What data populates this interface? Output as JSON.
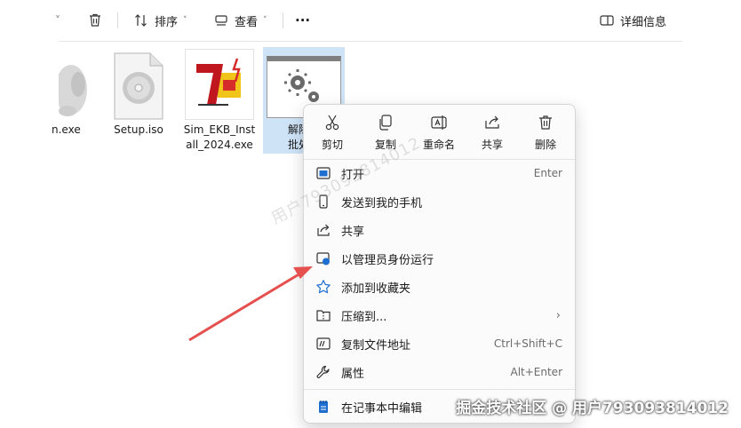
{
  "toolbar": {
    "sort_label": "排序",
    "view_label": "查看",
    "more_label": "···",
    "details_label": "详细信息"
  },
  "files": [
    {
      "name": "n.exe",
      "icon": "app-icon"
    },
    {
      "name": "Setup.iso",
      "icon": "disc-image-icon"
    },
    {
      "name": "Sim_EKB_Install_2024.exe",
      "line1": "Sim_EKB_Inst",
      "line2": "all_2024.exe",
      "icon": "installer-icon"
    },
    {
      "name": "解除重…批处理",
      "line1": "解除重",
      "line2": "批处理",
      "icon": "batch-file-icon",
      "selected": true
    }
  ],
  "context_menu": {
    "quick_actions": [
      {
        "label": "剪切",
        "icon": "cut-icon"
      },
      {
        "label": "复制",
        "icon": "copy-icon"
      },
      {
        "label": "重命名",
        "icon": "rename-icon"
      },
      {
        "label": "共享",
        "icon": "share-icon"
      },
      {
        "label": "删除",
        "icon": "delete-icon"
      }
    ],
    "items": [
      {
        "label": "打开",
        "shortcut": "Enter",
        "icon": "open-icon"
      },
      {
        "label": "发送到我的手机",
        "shortcut": "",
        "icon": "phone-icon"
      },
      {
        "label": "共享",
        "shortcut": "",
        "icon": "share-icon"
      },
      {
        "label": "以管理员身份运行",
        "shortcut": "",
        "icon": "shield-admin-icon"
      },
      {
        "label": "添加到收藏夹",
        "shortcut": "",
        "icon": "star-icon"
      },
      {
        "label": "压缩到...",
        "shortcut": "",
        "icon": "zip-icon",
        "submenu": true
      },
      {
        "label": "复制文件地址",
        "shortcut": "Ctrl+Shift+C",
        "icon": "copy-path-icon"
      },
      {
        "label": "属性",
        "shortcut": "Alt+Enter",
        "icon": "wrench-icon"
      },
      {
        "label": "在记事本中编辑",
        "shortcut": "",
        "icon": "notepad-icon"
      }
    ]
  },
  "watermark": {
    "diagonal": "用户793093814012",
    "footer": "掘金技术社区 @ 用户793093814012"
  },
  "colors": {
    "selection": "#cfe3f7",
    "accent_blue": "#1f6fd1",
    "arrow_red": "#e5504f"
  }
}
